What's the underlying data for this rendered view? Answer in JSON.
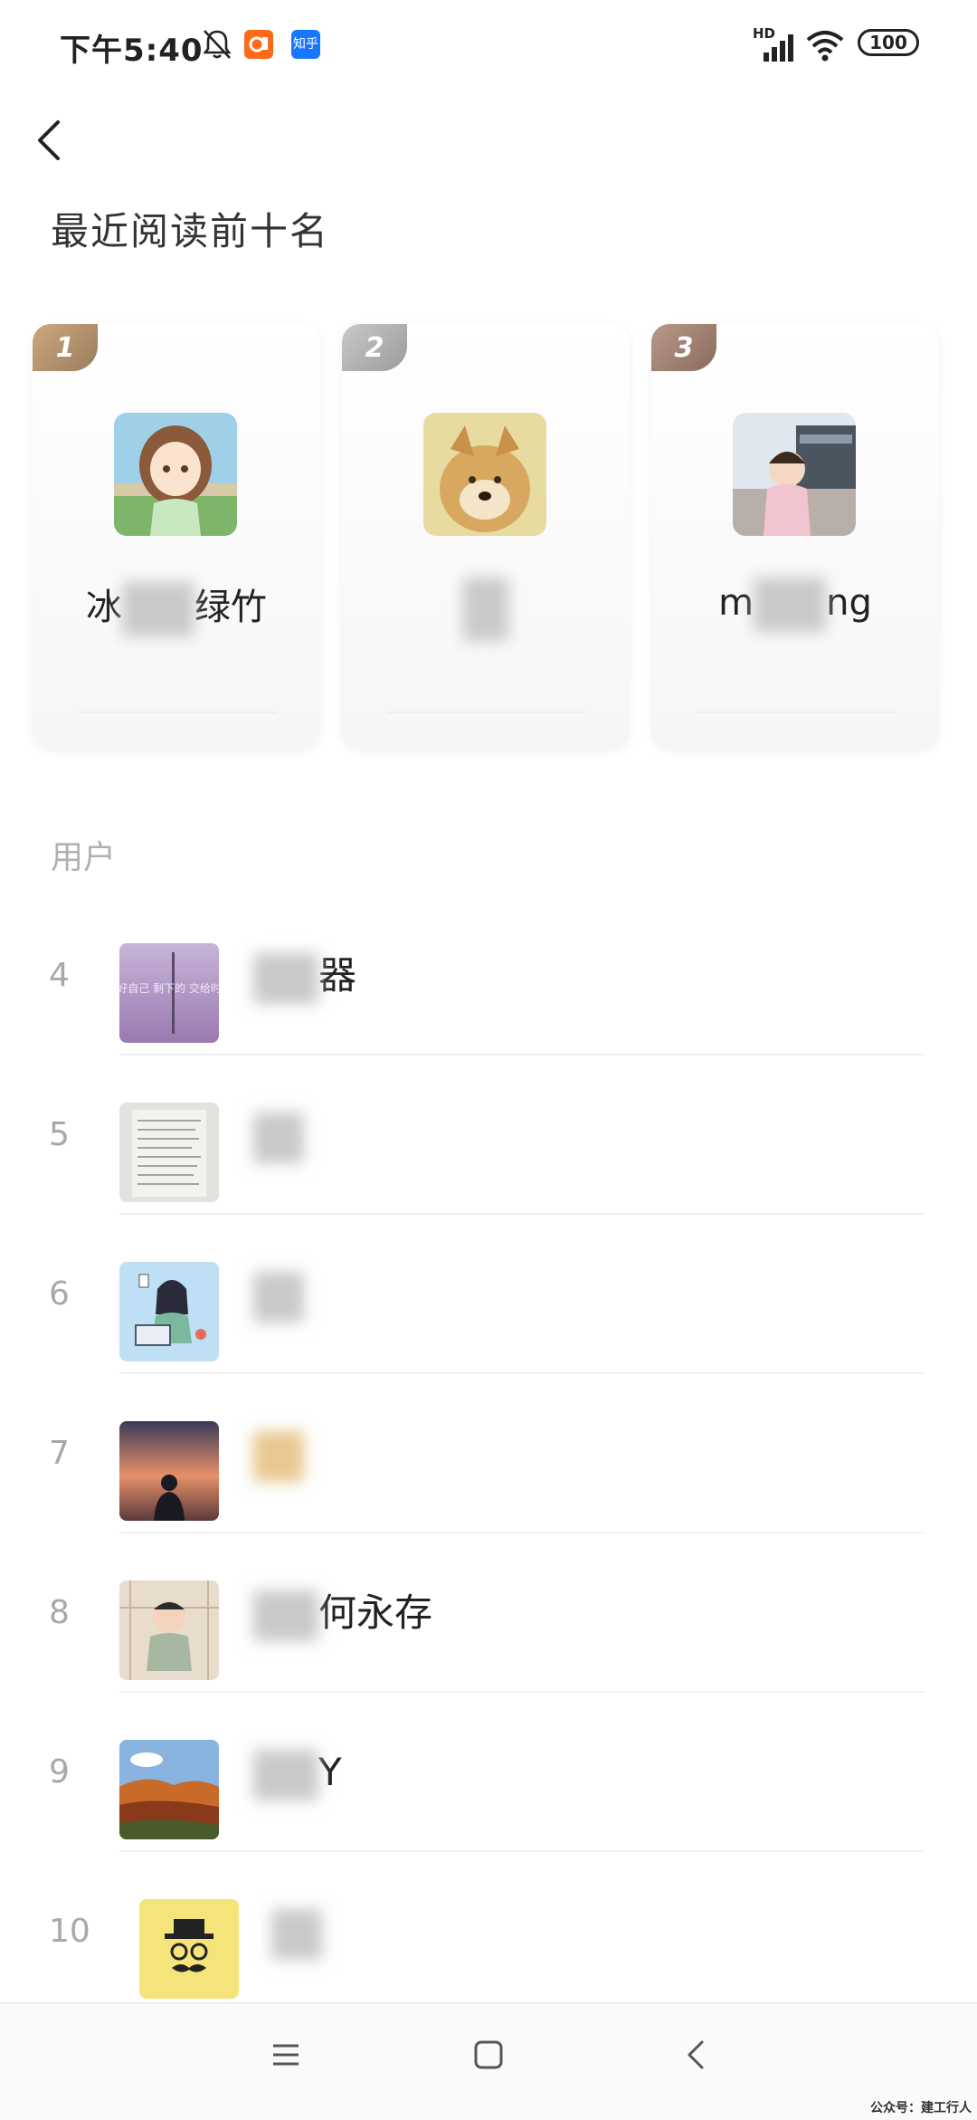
{
  "status_bar": {
    "time": "下午5:40",
    "notif_app2_label": "知乎",
    "network_label": "HD",
    "battery": "100"
  },
  "page": {
    "title": "最近阅读前十名",
    "section_label": "用户"
  },
  "top_three": [
    {
      "rank": "1",
      "name_prefix": "冰",
      "name_suffix": "绿竹"
    },
    {
      "rank": "2",
      "name_prefix": "",
      "name_suffix": ""
    },
    {
      "rank": "3",
      "name_prefix": "m",
      "name_suffix": "ng"
    }
  ],
  "users": [
    {
      "rank": "4",
      "name_suffix": "器"
    },
    {
      "rank": "5",
      "name_suffix": ""
    },
    {
      "rank": "6",
      "name_suffix": ""
    },
    {
      "rank": "7",
      "name_suffix": ""
    },
    {
      "rank": "8",
      "name_suffix": "何永存"
    },
    {
      "rank": "9",
      "name_suffix": "Y"
    },
    {
      "rank": "10",
      "name_suffix": ""
    }
  ],
  "avatar_4_text": "做好自己 剩下的 交给时间",
  "watermark": "公众号：建工行人"
}
